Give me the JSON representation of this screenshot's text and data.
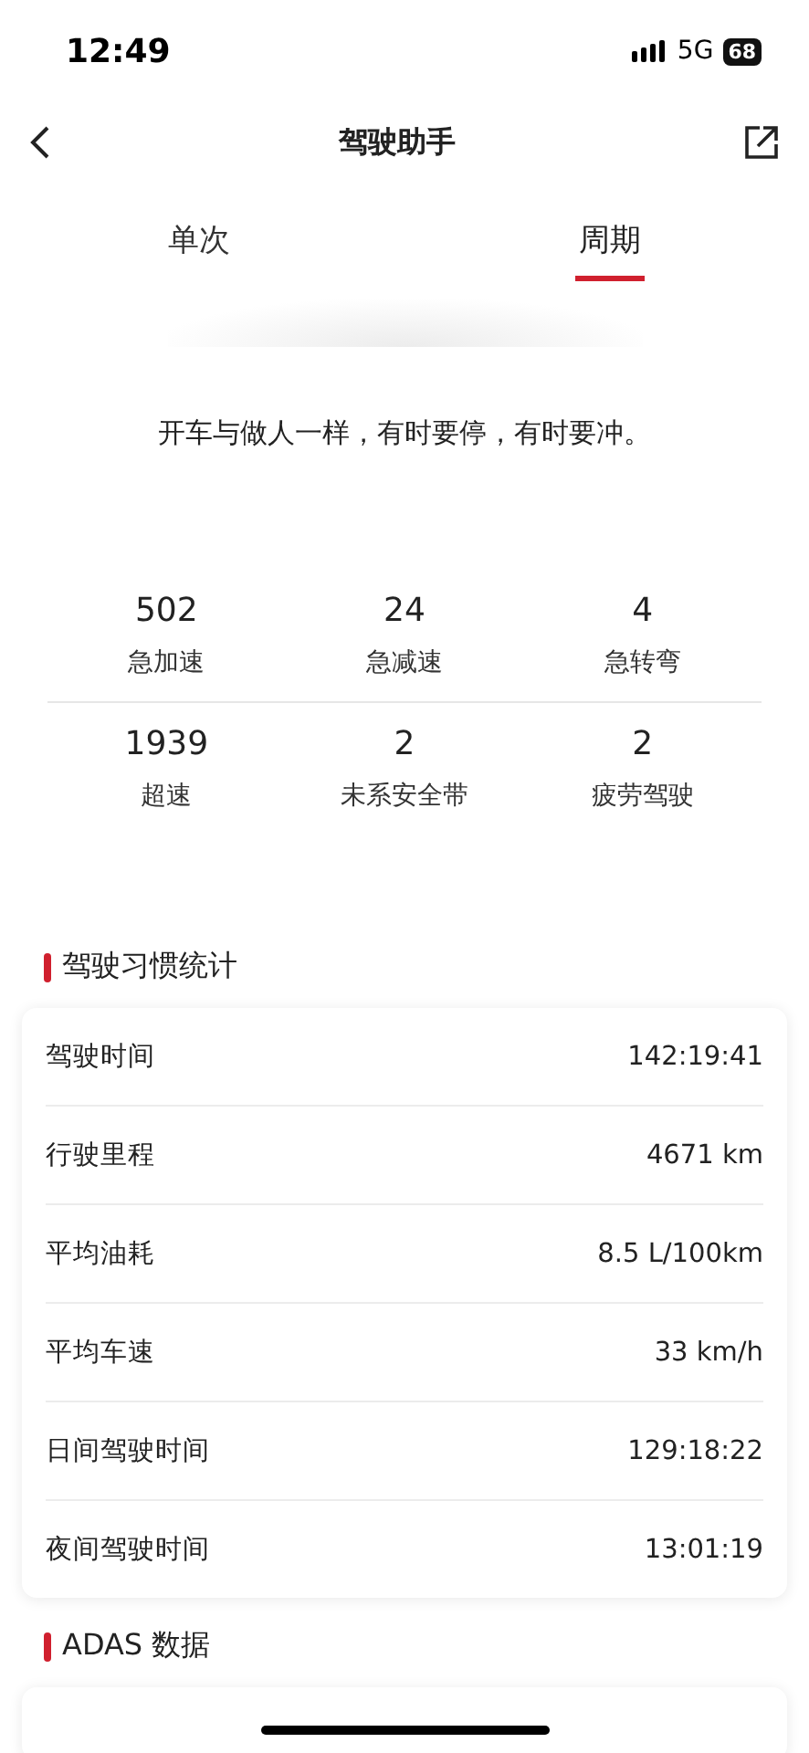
{
  "status_bar": {
    "time": "12:49",
    "network": "5G",
    "battery": "68"
  },
  "nav": {
    "title": "驾驶助手"
  },
  "tabs": [
    {
      "label": "单次",
      "selected": false
    },
    {
      "label": "周期",
      "selected": true
    }
  ],
  "motto": "开车与做人一样，有时要停，有时要冲。",
  "events": [
    {
      "value": "502",
      "label": "急加速"
    },
    {
      "value": "24",
      "label": "急减速"
    },
    {
      "value": "4",
      "label": "急转弯"
    },
    {
      "value": "1939",
      "label": "超速"
    },
    {
      "value": "2",
      "label": "未系安全带"
    },
    {
      "value": "2",
      "label": "疲劳驾驶"
    }
  ],
  "habits": {
    "title": "驾驶习惯统计",
    "rows": [
      {
        "label": "驾驶时间",
        "value": "142:19:41"
      },
      {
        "label": "行驶里程",
        "value": "4671 km"
      },
      {
        "label": "平均油耗",
        "value": "8.5 L/100km"
      },
      {
        "label": "平均车速",
        "value": "33 km/h"
      },
      {
        "label": "日间驾驶时间",
        "value": "129:18:22"
      },
      {
        "label": "夜间驾驶时间",
        "value": "13:01:19"
      }
    ]
  },
  "adas": {
    "title": "ADAS 数据"
  }
}
